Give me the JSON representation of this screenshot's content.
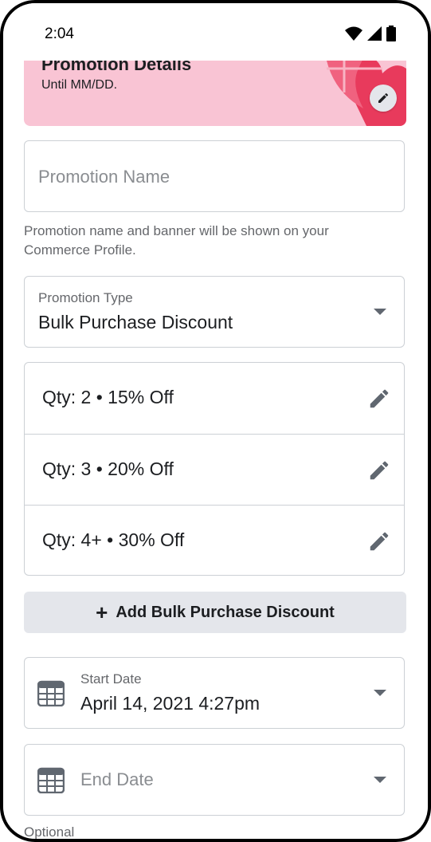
{
  "status_bar": {
    "time": "2:04"
  },
  "banner": {
    "title": "Promotion Details",
    "subtitle": "Until MM/DD."
  },
  "promotion_name": {
    "placeholder": "Promotion Name"
  },
  "helper_text": "Promotion name and banner will be shown on your Commerce Profile.",
  "promotion_type": {
    "label": "Promotion Type",
    "value": "Bulk Purchase Discount"
  },
  "discounts": [
    {
      "text": "Qty: 2 • 15% Off"
    },
    {
      "text": "Qty: 3 • 20% Off"
    },
    {
      "text": "Qty: 4+ • 30% Off"
    }
  ],
  "add_button": {
    "plus": "+",
    "label": "Add Bulk Purchase Discount"
  },
  "start_date": {
    "label": "Start Date",
    "value": "April 14, 2021 4:27pm"
  },
  "end_date": {
    "placeholder": "End Date",
    "hint": "Optional"
  },
  "colors": {
    "banner_bg": "#f9c4d4",
    "button_bg": "#e4e6eb",
    "border": "#ccd0d5"
  },
  "icons": [
    "wifi-icon",
    "signal-icon",
    "battery-icon",
    "pencil-icon",
    "dropdown-caret-icon",
    "calendar-icon",
    "plus-icon"
  ]
}
